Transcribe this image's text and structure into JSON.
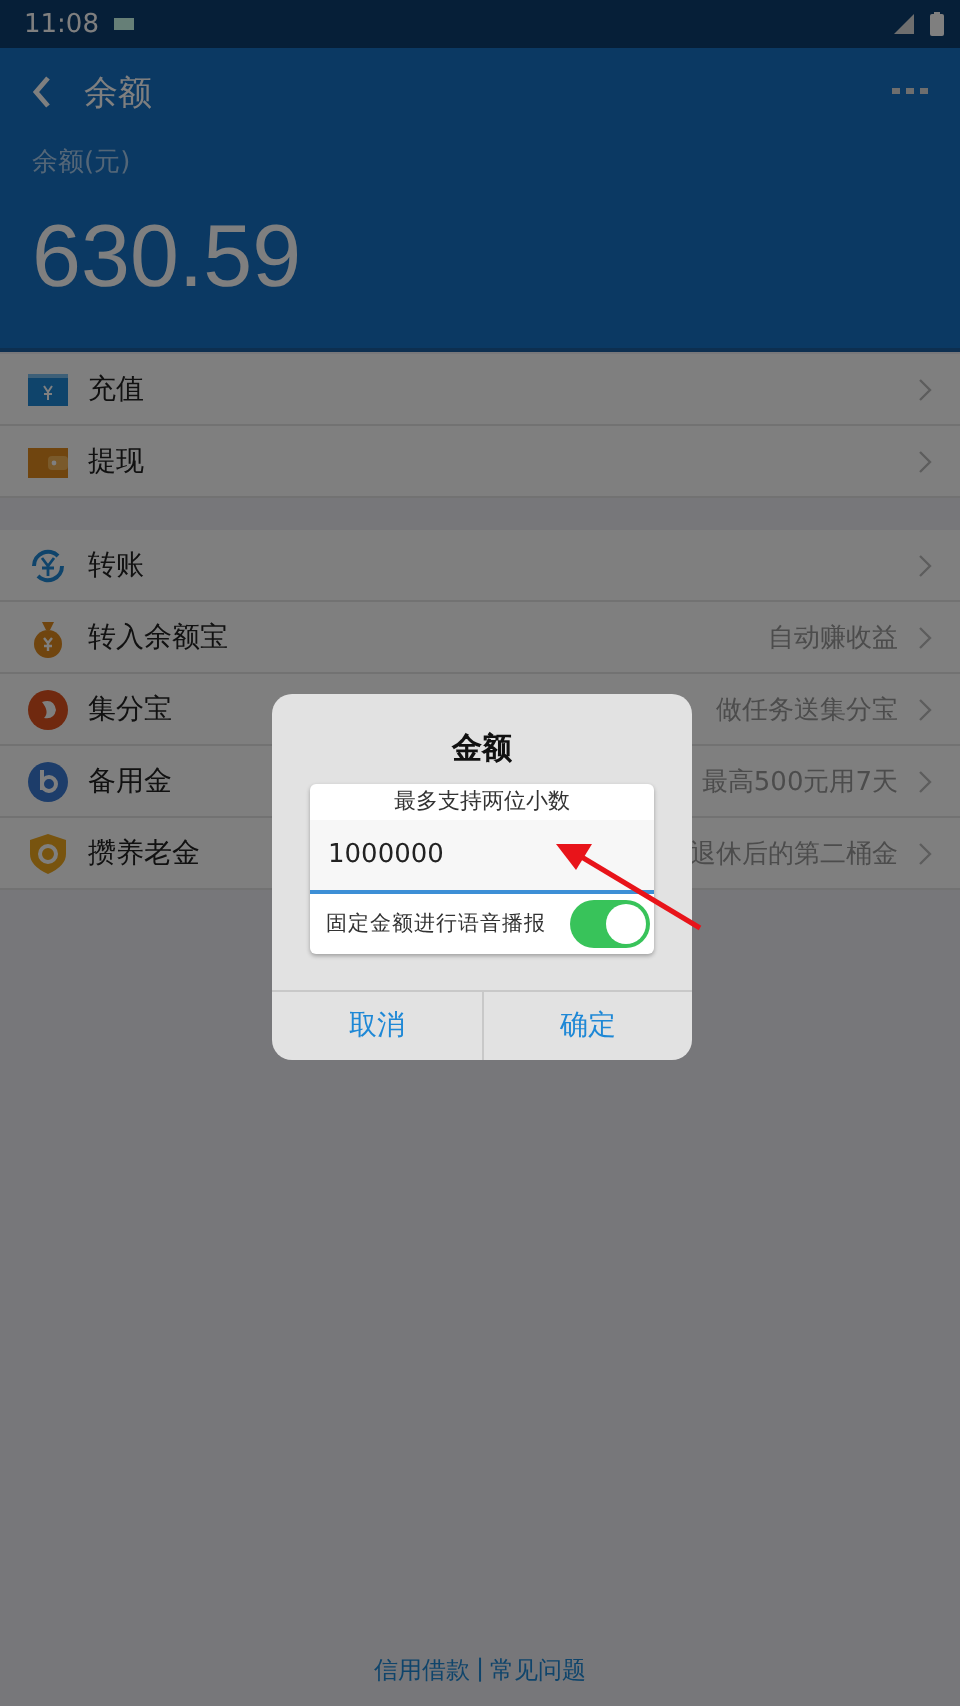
{
  "status_bar": {
    "time": "11:08"
  },
  "header": {
    "title": "余额",
    "balance_label": "余额(元)",
    "balance": "630.59"
  },
  "menu_groups": [
    [
      {
        "label": "充值"
      },
      {
        "label": "提现"
      }
    ],
    [
      {
        "label": "转账"
      },
      {
        "label": "转入余额宝",
        "detail": "自动赚收益"
      },
      {
        "label": "集分宝",
        "detail": "做任务送集分宝"
      },
      {
        "label": "备用金",
        "detail": "最高500元用7天"
      },
      {
        "label": "攒养老金",
        "detail": "退休后的第二桶金"
      }
    ]
  ],
  "footer": {
    "links": [
      "信用借款",
      "常见问题"
    ],
    "separator": "|"
  },
  "dialog": {
    "title": "金额",
    "hint": "最多支持两位小数",
    "value": "1000000",
    "toggle": {
      "label": "固定金额进行语音播报",
      "on": true
    },
    "buttons": [
      "取消",
      "确定"
    ]
  }
}
